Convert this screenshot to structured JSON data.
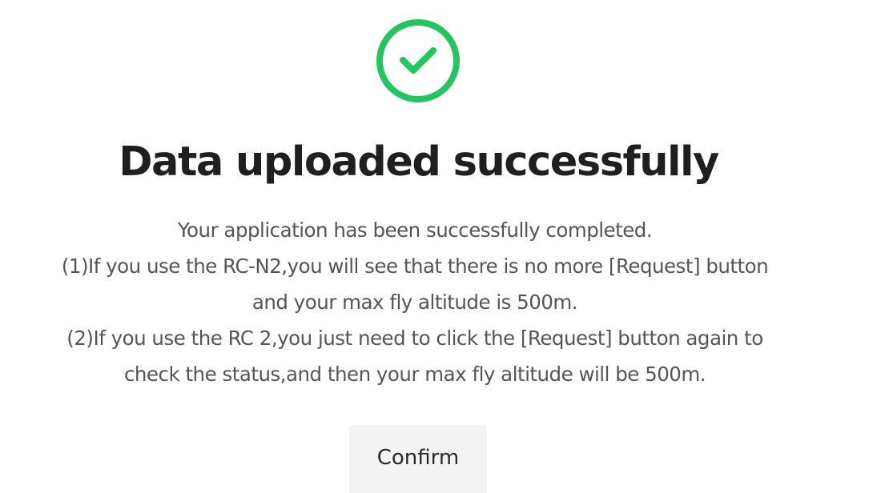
{
  "status": {
    "icon": "check-circle-icon",
    "color": "#22c55e"
  },
  "title": "Data uploaded successfully",
  "message": {
    "lines": [
      "Your application has been successfully completed.",
      "(1)If you use the RC-N2,you will see that there is no more [Request] button",
      "and your max fly altitude is 500m.",
      "(2)If you use the RC 2,you just need to click the [Request] button again to",
      "check the status,and then your max fly altitude will be 500m."
    ]
  },
  "confirm_label": "Confirm"
}
